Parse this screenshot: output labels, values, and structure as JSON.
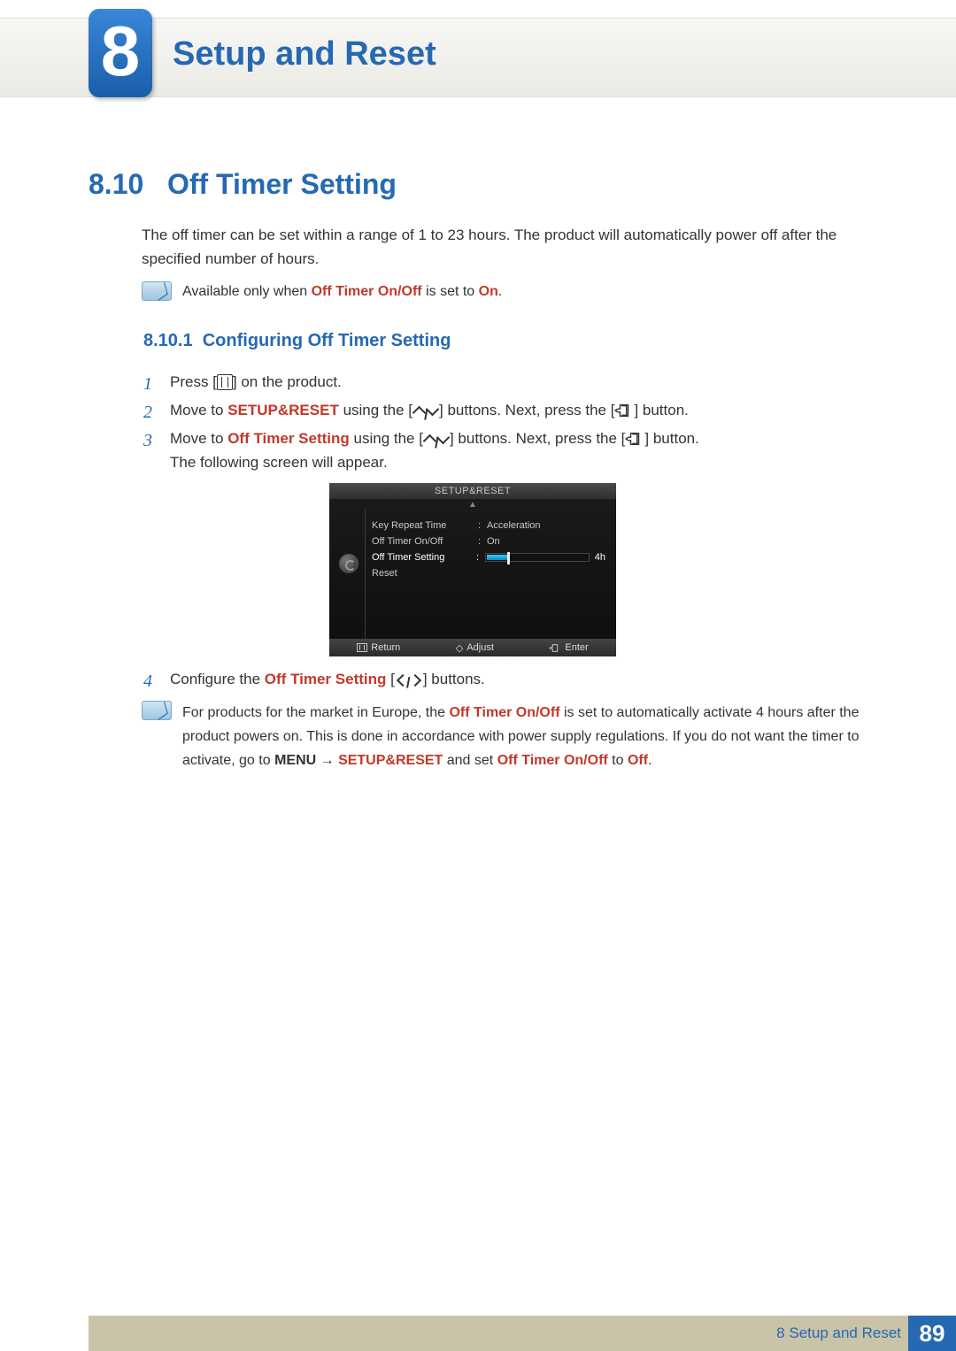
{
  "chapter": {
    "number": "8",
    "title": "Setup and Reset"
  },
  "section": {
    "number": "8.10",
    "title": "Off Timer Setting"
  },
  "intro": "The off timer can be set within a range of 1 to 23 hours. The product will automatically power off after the specified number of hours.",
  "note1": {
    "prefix": "Available only when ",
    "bold1": "Off Timer On/Off",
    "mid": " is set to ",
    "bold2": "On",
    "suffix": "."
  },
  "subsection": {
    "number": "8.10.1",
    "title": "Configuring Off Timer Setting"
  },
  "steps": {
    "s1_a": "Press [",
    "s1_b": "] on the product.",
    "s2_a": "Move to ",
    "s2_hl": "SETUP&RESET",
    "s2_b": " using the [",
    "s2_c": "] buttons. Next, press the [",
    "s2_d": "] button.",
    "s3_a": "Move to ",
    "s3_hl": "Off Timer Setting",
    "s3_b": " using the [",
    "s3_c": "] buttons. Next, press the [",
    "s3_d": "] button.",
    "s3_tail": "The following screen will appear.",
    "s4_a": "Configure the ",
    "s4_hl": "Off Timer Setting",
    "s4_b": " [",
    "s4_c": "] buttons."
  },
  "osd": {
    "title": "SETUP&RESET",
    "rows": {
      "r1_label": "Key Repeat Time",
      "r1_val": "Acceleration",
      "r2_label": "Off Timer On/Off",
      "r2_val": "On",
      "r3_label": "Off Timer Setting",
      "r3_val": "4h",
      "r4_label": "Reset"
    },
    "colon": ":",
    "footer": {
      "return": "Return",
      "adjust": "Adjust",
      "enter": "Enter"
    }
  },
  "note2": {
    "t1": "For products for the market in Europe, the ",
    "hl1": "Off Timer On/Off",
    "t2": " is set to automatically activate 4 hours after the product powers on. This is done in accordance with power supply regulations. If you do not want the timer to activate, go to ",
    "b1": "MENU",
    "arrow": " → ",
    "hl2": "SETUP&RESET",
    "t3": " and set ",
    "hl3": "Off Timer On/Off",
    "t4": " to ",
    "hl4": "Off",
    "t5": "."
  },
  "footer": {
    "text": "8 Setup and Reset",
    "page": "89"
  }
}
